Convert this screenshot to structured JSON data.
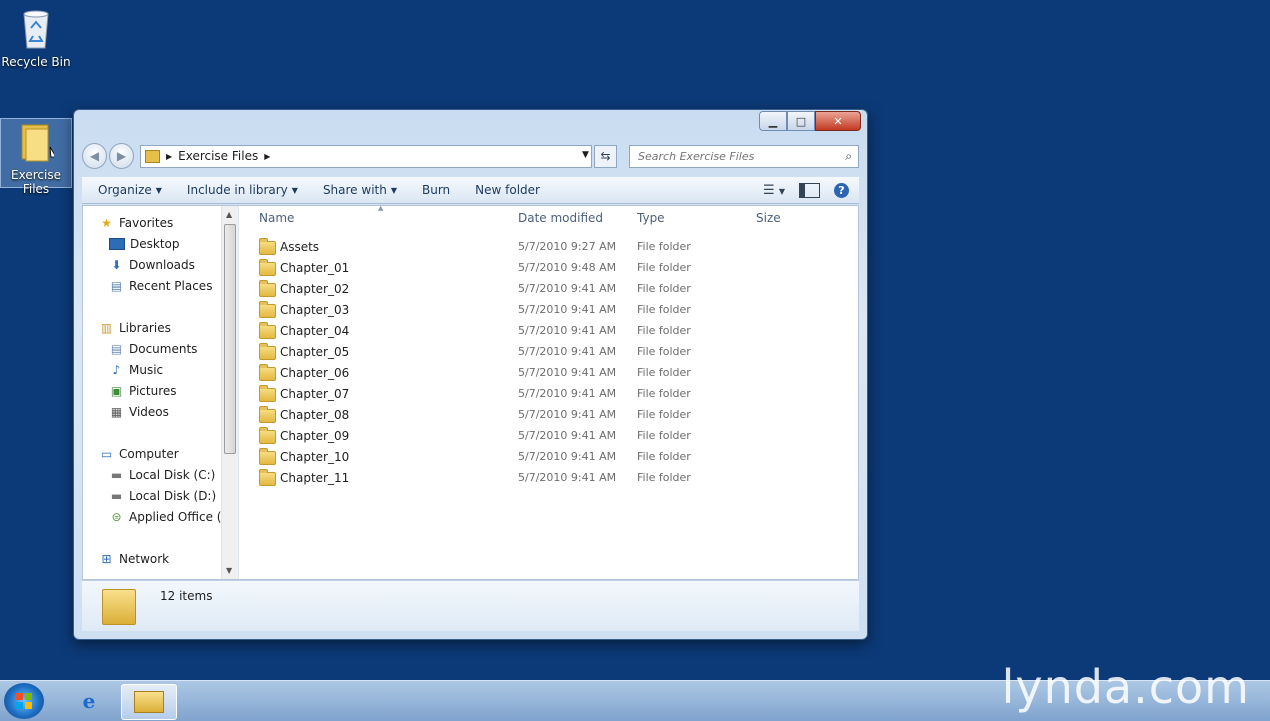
{
  "desktop": {
    "icons": [
      {
        "label": "Recycle Bin",
        "icon": "recycle-bin-icon"
      },
      {
        "label": "Exercise Files",
        "icon": "folder-icon"
      }
    ]
  },
  "window": {
    "address": {
      "crumb": "Exercise Files"
    },
    "search": {
      "placeholder": "Search Exercise Files"
    },
    "toolbar": {
      "organize": "Organize",
      "include_in_library": "Include in library",
      "share_with": "Share with",
      "burn": "Burn",
      "new_folder": "New folder"
    },
    "nav": {
      "favorites": "Favorites",
      "desktop": "Desktop",
      "downloads": "Downloads",
      "recent_places": "Recent Places",
      "libraries": "Libraries",
      "documents": "Documents",
      "music": "Music",
      "pictures": "Pictures",
      "videos": "Videos",
      "computer": "Computer",
      "local_c": "Local Disk (C:)",
      "local_d": "Local Disk (D:)",
      "applied_office": "Applied Office (F",
      "network": "Network"
    },
    "columns": {
      "name": "Name",
      "date_modified": "Date modified",
      "type": "Type",
      "size": "Size"
    },
    "files": [
      {
        "name": "Assets",
        "date": "5/7/2010 9:27 AM",
        "type": "File folder"
      },
      {
        "name": "Chapter_01",
        "date": "5/7/2010 9:48 AM",
        "type": "File folder"
      },
      {
        "name": "Chapter_02",
        "date": "5/7/2010 9:41 AM",
        "type": "File folder"
      },
      {
        "name": "Chapter_03",
        "date": "5/7/2010 9:41 AM",
        "type": "File folder"
      },
      {
        "name": "Chapter_04",
        "date": "5/7/2010 9:41 AM",
        "type": "File folder"
      },
      {
        "name": "Chapter_05",
        "date": "5/7/2010 9:41 AM",
        "type": "File folder"
      },
      {
        "name": "Chapter_06",
        "date": "5/7/2010 9:41 AM",
        "type": "File folder"
      },
      {
        "name": "Chapter_07",
        "date": "5/7/2010 9:41 AM",
        "type": "File folder"
      },
      {
        "name": "Chapter_08",
        "date": "5/7/2010 9:41 AM",
        "type": "File folder"
      },
      {
        "name": "Chapter_09",
        "date": "5/7/2010 9:41 AM",
        "type": "File folder"
      },
      {
        "name": "Chapter_10",
        "date": "5/7/2010 9:41 AM",
        "type": "File folder"
      },
      {
        "name": "Chapter_11",
        "date": "5/7/2010 9:41 AM",
        "type": "File folder"
      }
    ],
    "details": {
      "count": "12 items"
    }
  },
  "watermark": "lynda.com",
  "colors": {
    "desktop": "#0c3a78",
    "accent": "#2b66b6"
  }
}
